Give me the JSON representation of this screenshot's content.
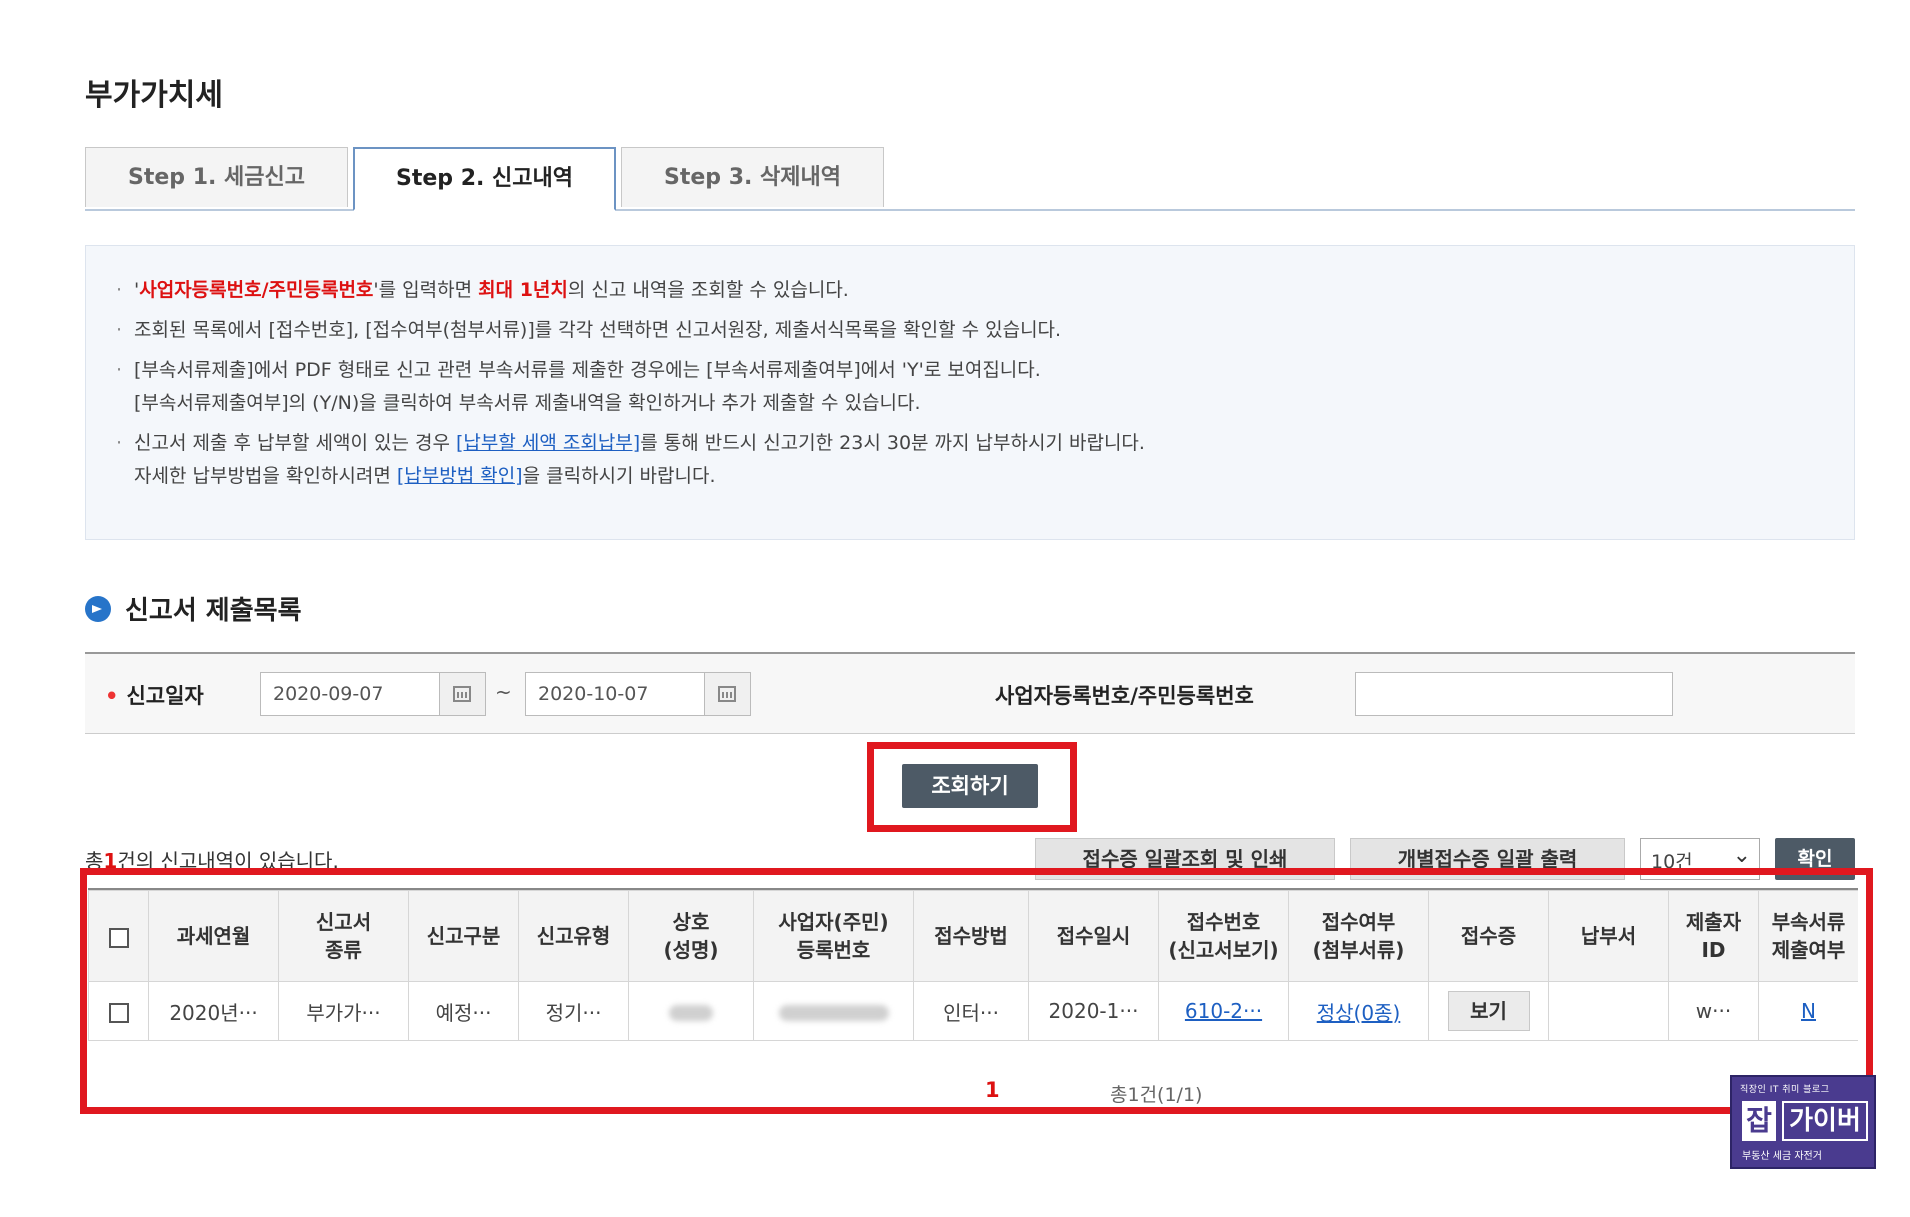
{
  "page": {
    "title": "부가가치세"
  },
  "tabs": [
    {
      "label": "Step 1. 세금신고"
    },
    {
      "label": "Step 2. 신고내역"
    },
    {
      "label": "Step 3. 삭제내역"
    }
  ],
  "info": {
    "i1_a": "'",
    "i1_b": "사업자등록번호/주민등록번호",
    "i1_c": "'를 입력하면 ",
    "i1_d": "최대 1년치",
    "i1_e": "의 신고 내역을 조회할 수 있습니다.",
    "i2": "조회된 목록에서 [접수번호], [접수여부(첨부서류)]를 각각 선택하면 신고서원장, 제출서식목록을 확인할 수 있습니다.",
    "i3_l1": "[부속서류제출]에서 PDF 형태로 신고 관련 부속서류를 제출한 경우에는 [부속서류제출여부]에서 'Y'로 보여집니다.",
    "i3_l2": "[부속서류제출여부]의 (Y/N)을 클릭하여 부속서류 제출내역을 확인하거나 추가 제출할 수 있습니다.",
    "i4_a": "신고서 제출 후 납부할 세액이 있는 경우 ",
    "i4_link": "[납부할 세액 조회납부]",
    "i4_b": "를 통해 반드시 신고기한 23시 30분 까지 납부하시기 바랍니다.",
    "i4_c": "자세한 납부방법을 확인하시려면 ",
    "i4_link2": "[납부방법 확인]",
    "i4_d": "을 클릭하시기 바랍니다."
  },
  "section": {
    "title": "신고서 제출목록"
  },
  "search": {
    "date_label": "신고일자",
    "date_from": "2020-09-07",
    "tilde": "~",
    "date_to": "2020-10-07",
    "id_label": "사업자등록번호/주민등록번호",
    "id_value": "",
    "submit": "조회하기"
  },
  "list": {
    "count_prefix": "총",
    "count": "1",
    "count_suffix": "건의 신고내역이 있습니다.",
    "btn_bulk": "접수증 일괄조회 및 인쇄",
    "btn_individual": "개별접수증 일괄 출력",
    "page_size": "10건",
    "btn_confirm": "확인"
  },
  "table": {
    "headers": [
      [
        "과세연월"
      ],
      [
        "신고서",
        "종류"
      ],
      [
        "신고구분"
      ],
      [
        "신고유형"
      ],
      [
        "상호",
        "(성명)"
      ],
      [
        "사업자(주민)",
        "등록번호"
      ],
      [
        "접수방법"
      ],
      [
        "접수일시"
      ],
      [
        "접수번호",
        "(신고서보기)"
      ],
      [
        "접수여부",
        "(첨부서류)"
      ],
      [
        "접수증"
      ],
      [
        "납부서"
      ],
      [
        "제출자",
        "ID"
      ],
      [
        "부속서류",
        "제출여부"
      ]
    ],
    "row": {
      "period": "2020년···",
      "kind": "부가가···",
      "category": "예정···",
      "type": "정기···",
      "receipt_method": "인터···",
      "received_at": "2020-1···",
      "receipt_no": "610-2···",
      "status": "정상(0종)",
      "view": "보기",
      "submitter": "w···",
      "attach": "N"
    }
  },
  "pagination": {
    "current": "1",
    "total": "총1건(1/1)"
  },
  "watermark": {
    "top": "직장인 IT 취미 블로그",
    "badge": "잡",
    "name": "가이버",
    "bottom": "부동산 세금 자전거"
  }
}
